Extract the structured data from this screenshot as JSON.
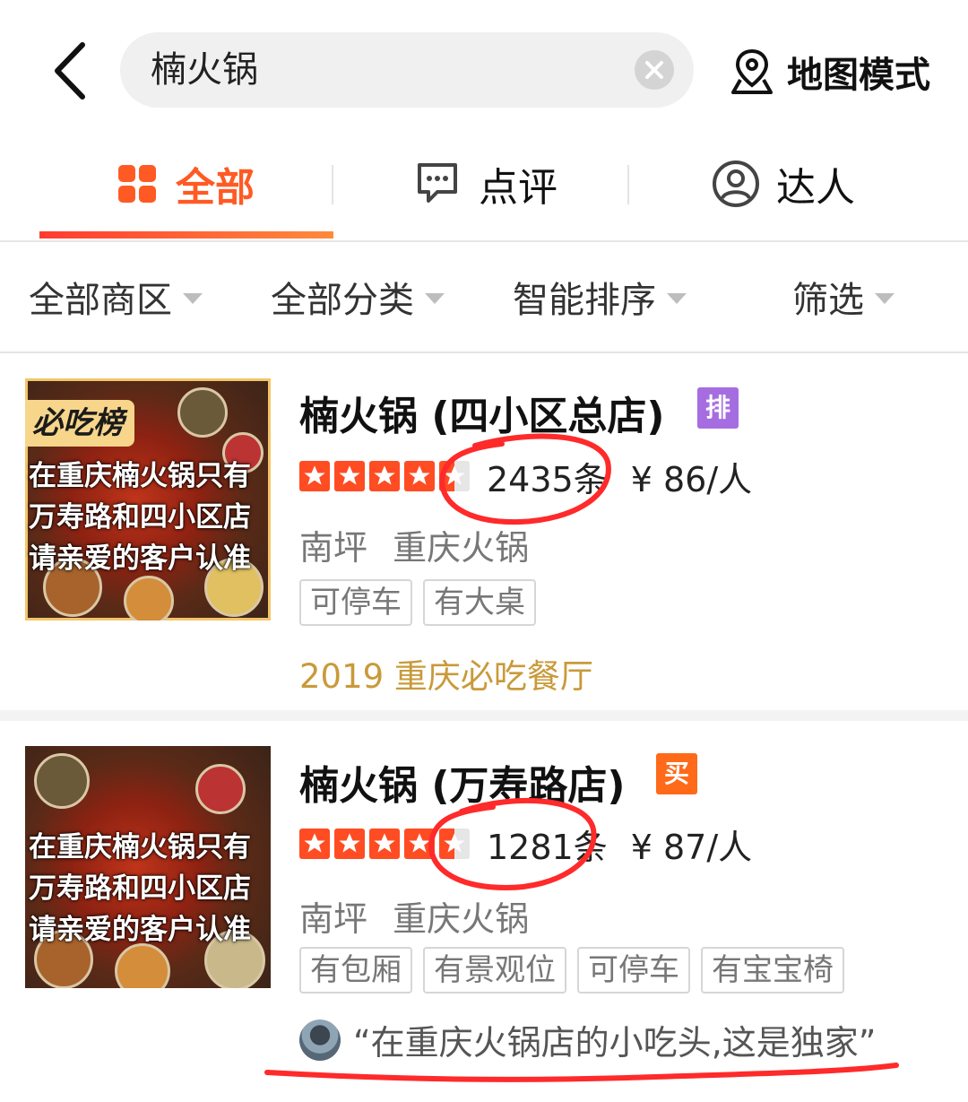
{
  "colors": {
    "accent": "#ff5a23",
    "star": "#ff4c23",
    "honor": "#c99a3a",
    "annotation": "#ff2a2a"
  },
  "header": {
    "back_icon": "chevron-left-icon",
    "search_value": "楠火锅",
    "clear_icon": "clear-icon",
    "map_mode_icon": "map-pin-icon",
    "map_mode_label": "地图模式"
  },
  "tabs": [
    {
      "label": "全部",
      "icon": "grid-icon",
      "active": true
    },
    {
      "label": "点评",
      "icon": "comment-icon",
      "active": false
    },
    {
      "label": "达人",
      "icon": "user-icon",
      "active": false
    }
  ],
  "filters": [
    {
      "label": "全部商区"
    },
    {
      "label": "全部分类"
    },
    {
      "label": "智能排序"
    },
    {
      "label": "筛选"
    }
  ],
  "results": [
    {
      "name": "楠火锅 (四小区总店)",
      "badge": "排",
      "rating_stars": 4.5,
      "review_count": "2435条",
      "price": "¥ 86/人",
      "area": "南坪",
      "category": "重庆火锅",
      "features": [
        "可停车",
        "有大桌"
      ],
      "honor": "2019 重庆必吃餐厅",
      "thumb_badge": "必吃榜",
      "thumb_text": [
        "在重庆楠火锅只有",
        "万寿路和四小区店",
        "请亲爱的客户认准"
      ]
    },
    {
      "name": "楠火锅 (万寿路店)",
      "badge": "买",
      "rating_stars": 4.5,
      "review_count": "1281条",
      "price": "¥ 87/人",
      "area": "南坪",
      "category": "重庆火锅",
      "features": [
        "有包厢",
        "有景观位",
        "可停车",
        "有宝宝椅"
      ],
      "quote": "“在重庆火锅店的小吃头,这是独家”",
      "thumb_text": [
        "在重庆楠火锅只有",
        "万寿路和四小区店",
        "请亲爱的客户认准"
      ]
    }
  ]
}
